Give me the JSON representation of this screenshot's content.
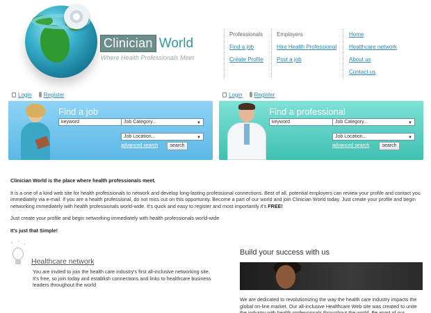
{
  "brand": {
    "name_boxed": "Clinician",
    "name_rest": "World",
    "tagline": "Where Health Professionals Meet"
  },
  "nav": {
    "professionals": {
      "heading": "Professionals",
      "links": [
        "Find a job",
        "Create Profile"
      ]
    },
    "employers": {
      "heading": "Employers",
      "links": [
        "Hire Health Professional",
        "Post a job"
      ]
    },
    "site": {
      "links": [
        "Home",
        "Healthcare network",
        "About us",
        "Contact us"
      ]
    }
  },
  "auth": {
    "login": "Login",
    "register": "Register"
  },
  "find_job": {
    "title": "Find a job",
    "keyword_value": "keyword",
    "category_value": "Job Category...",
    "location_value": "Job Location...",
    "advanced": "advanced search",
    "search": "search"
  },
  "find_pro": {
    "title": "Find a professional",
    "keyword_value": "keyword",
    "category_value": "Job Category...",
    "location_value": "Job Location...",
    "advanced": "advanced search",
    "search": "search"
  },
  "content": {
    "headline": "Clinician World is the place where health professionals meet.",
    "para1": "It is a one of a kind web site for health professionals to network and develop long-lasting professional connections. Best of all, potential employers can review your profile and contact you immediately via e-mail. If you are a health professional, do not miss out on this opportunity. Become a part of our world and join Clinician World today. Just create your profile and begin networking immediately with health professionals world-wide. It's quick and easy to register and most importantly it's",
    "para1_bold": "FREE!",
    "para2": "Just create your profile and begin networking immediately with health professionals world-wide",
    "para3": "It's just that Simple!"
  },
  "healthcare_network": {
    "title": "Healthcare network",
    "text": "You are invited to join the health care industry's first all-inclusive networking site. It's free, so join today and establish connections and links to healthcare business leaders throughout the world"
  },
  "build": {
    "title": "Build your success with us",
    "text": "We are dedicated to revolutionizing the way the health care industry impacts the global on-line market. Our all-inclusive Healthcare Web site was created to unite the industry with health professionals throughout the world. Be apart of our"
  }
}
